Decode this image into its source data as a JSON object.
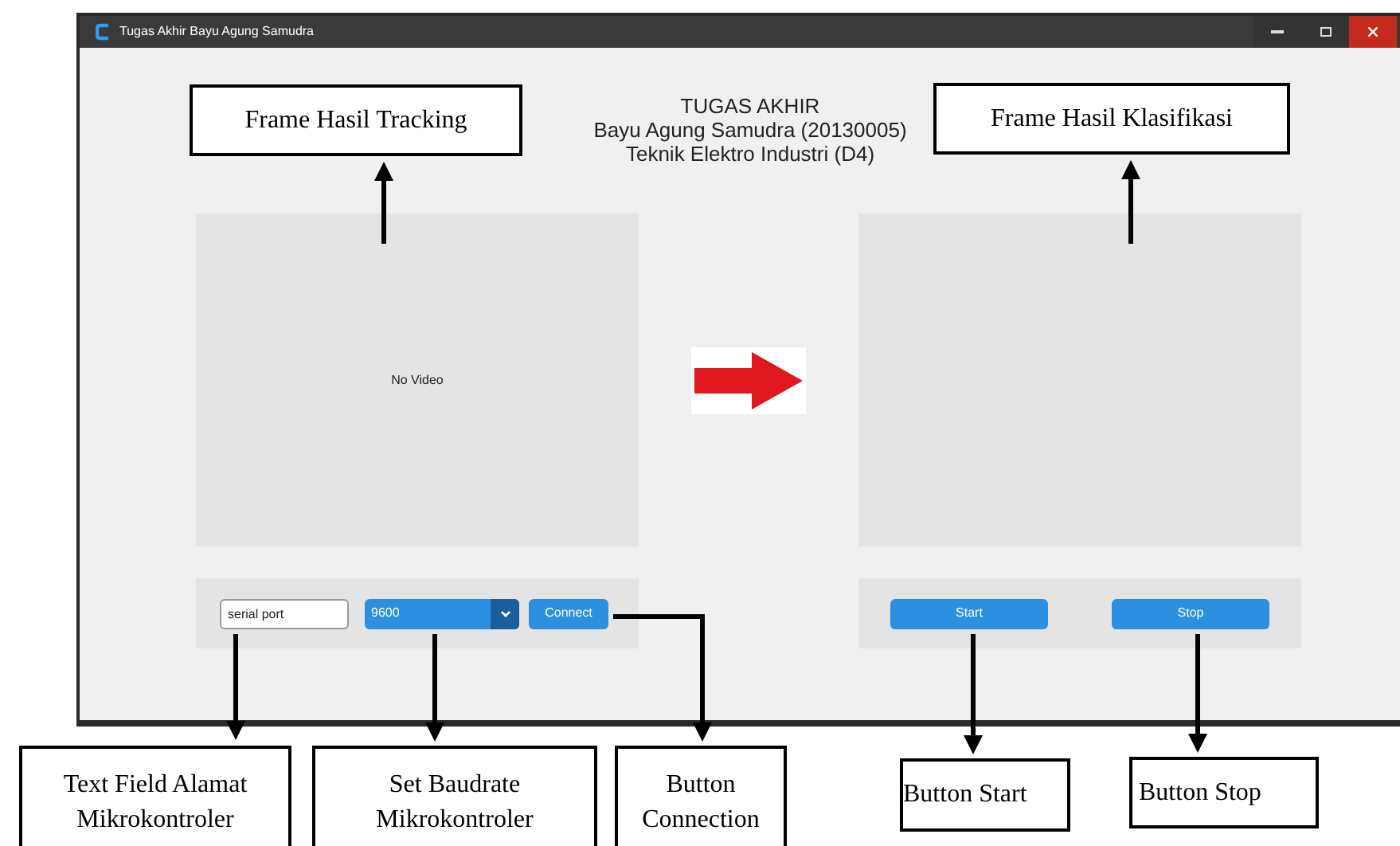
{
  "window": {
    "title": "Tugas Akhir Bayu Agung Samudra"
  },
  "header": [
    "TUGAS AKHIR",
    "Bayu Agung Samudra (20130005)",
    "Teknik Elektro Industri (D4)"
  ],
  "tracking_frame": {
    "text": "No Video"
  },
  "serial_field": {
    "value": "serial port"
  },
  "baudrate_dropdown": {
    "value": "9600"
  },
  "connect_button": {
    "label": "Connect"
  },
  "start_button": {
    "label": "Start"
  },
  "stop_button": {
    "label": "Stop"
  },
  "annotations": [
    {
      "text": "Frame Hasil Tracking"
    },
    {
      "text": "Frame Hasil Klasifikasi"
    },
    {
      "text": "Text Field Alamat Mikrokontroler"
    },
    {
      "text": "Set Baudrate Mikrokontroler"
    },
    {
      "text": "Button Connection"
    },
    {
      "text": "Button Start"
    },
    {
      "text": "Button Stop"
    }
  ]
}
